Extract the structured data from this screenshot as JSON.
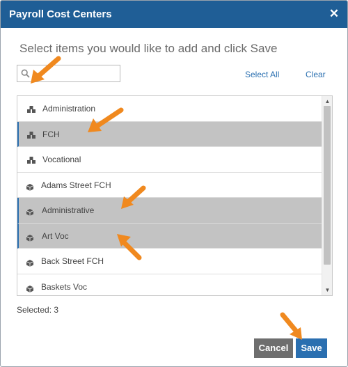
{
  "dialog": {
    "title": "Payroll Cost Centers",
    "close_symbol": "✕",
    "instruction": "Select items you would like to add and click Save"
  },
  "search": {
    "value": "",
    "placeholder": ""
  },
  "actions": {
    "select_all": "Select All",
    "clear": "Clear"
  },
  "items": [
    {
      "label": "Administration",
      "icon": "group-cubes-icon",
      "selected": false
    },
    {
      "label": "FCH",
      "icon": "group-cubes-icon",
      "selected": true
    },
    {
      "label": "Vocational",
      "icon": "group-cubes-icon",
      "selected": false
    },
    {
      "label": "Adams Street FCH",
      "icon": "cube-icon",
      "selected": false
    },
    {
      "label": "Administrative",
      "icon": "cube-icon",
      "selected": true
    },
    {
      "label": "Art Voc",
      "icon": "cube-icon",
      "selected": true
    },
    {
      "label": "Back Street FCH",
      "icon": "cube-icon",
      "selected": false
    },
    {
      "label": "Baskets Voc",
      "icon": "cube-icon",
      "selected": false
    }
  ],
  "footer": {
    "selected_text": "Selected: 3",
    "cancel_label": "Cancel",
    "save_label": "Save"
  },
  "colors": {
    "header": "#1f5e96",
    "accent": "#2a6fb0",
    "selected_row": "#c3c3c3",
    "annotation_arrow": "#f0891f"
  },
  "annotations": [
    "orange-arrow",
    "orange-arrow",
    "orange-arrow",
    "orange-arrow",
    "orange-arrow",
    "orange-arrow"
  ]
}
